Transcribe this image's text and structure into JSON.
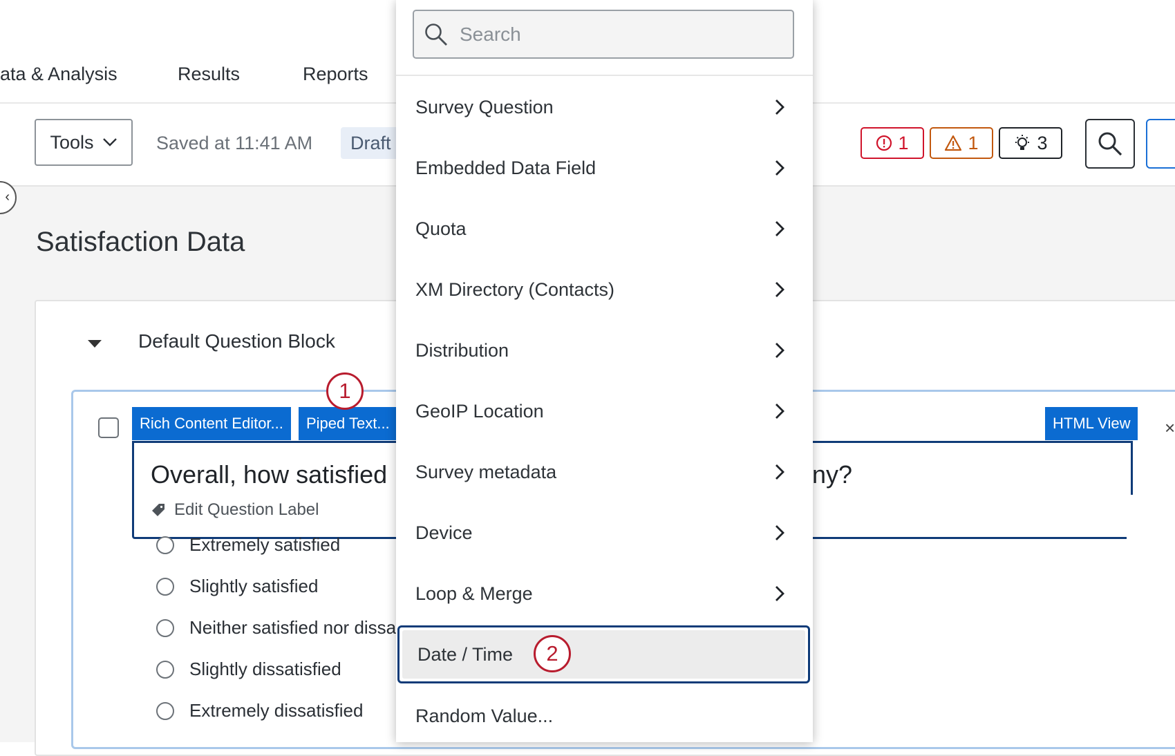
{
  "nav": {
    "tabs": [
      "ata & Analysis",
      "Results",
      "Reports"
    ]
  },
  "toolbar": {
    "tools_label": "Tools",
    "saved_text": "Saved at 11:41 AM",
    "status_badge": "Draft",
    "error_count": "1",
    "warning_count": "1",
    "suggestion_count": "3"
  },
  "survey": {
    "title": "Satisfaction Data",
    "block_title": "Default Question Block"
  },
  "question": {
    "editor_tabs": {
      "rich_content": "Rich Content Editor...",
      "piped_text": "Piped Text...",
      "html_view": "HTML View"
    },
    "text_visible_left": "Overall, how satisfied",
    "text_visible_right": "ny?",
    "edit_label": "Edit Question Label",
    "choices": [
      "Extremely satisfied",
      "Slightly satisfied",
      "Neither satisfied nor dissa",
      "Slightly dissatisfied",
      "Extremely dissatisfied"
    ]
  },
  "menu": {
    "search_placeholder": "Search",
    "items": [
      "Survey Question",
      "Embedded Data Field",
      "Quota",
      "XM Directory (Contacts)",
      "Distribution",
      "GeoIP Location",
      "Survey metadata",
      "Device",
      "Loop & Merge",
      "Date / Time",
      "Random Value..."
    ]
  },
  "callouts": {
    "step1": "1",
    "step2": "2"
  },
  "colors": {
    "accent_blue": "#0b6bd1",
    "focus_navy": "#0f3b78",
    "error_red": "#d0142b",
    "warning_orange": "#c2580e",
    "callout_red": "#b81c2e"
  }
}
